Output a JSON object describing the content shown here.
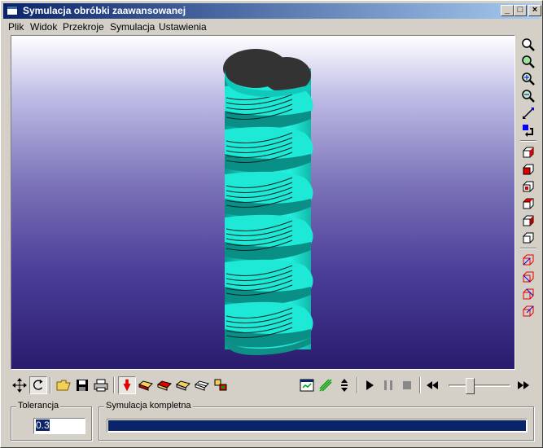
{
  "window": {
    "title": "Symulacja obróbki zaawansowanej"
  },
  "title_buttons": {
    "minimize": "_",
    "maximize": "□",
    "close": "×"
  },
  "menu": [
    "Plik",
    "Widok",
    "Przekroje",
    "Symulacja",
    "Ustawienia"
  ],
  "view_toolbar": [
    "zoom-icon",
    "zoom-window-icon",
    "zoom-in-icon",
    "zoom-out-icon",
    "zoom-extents-icon",
    "zoom-previous-icon",
    "view-front-icon",
    "view-back-icon",
    "view-left-icon",
    "view-right-icon",
    "view-top-icon",
    "view-bottom-icon",
    "iso-view-1-icon",
    "iso-view-2-icon",
    "iso-view-3-icon",
    "iso-view-4-icon"
  ],
  "bottom_toolbar": [
    "pan-icon",
    "rotate-icon",
    "open-icon",
    "save-icon",
    "print-icon",
    "tool-icon",
    "stock-icon",
    "part-icon",
    "fixture-icon",
    "wireframe-icon",
    "compare-icon",
    "report-icon",
    "toolpath-icon",
    "step-icon",
    "play-icon",
    "pause-icon",
    "stop-icon",
    "rewind-icon",
    "fast-forward-icon"
  ],
  "speed": {
    "value_fraction": 0.33
  },
  "tolerance": {
    "label": "Tolerancja",
    "value": "0.3"
  },
  "simulation": {
    "label": "Symulacja kompletna",
    "progress": 1.0
  },
  "colors": {
    "model": "#1ee8d6",
    "model_dark": "#0a8f86",
    "top_face": "#333333",
    "highlight": "#0a246a"
  }
}
